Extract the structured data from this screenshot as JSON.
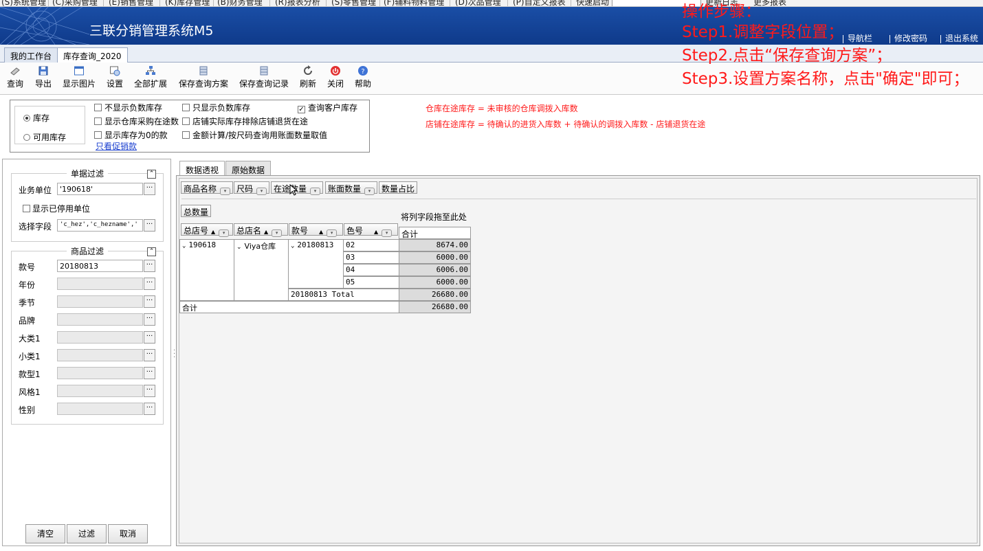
{
  "menu": {
    "items": [
      "(S)系统管理",
      "(C)采购管理",
      "(E)销售管理",
      "(K)库存管理",
      "(B)财务管理",
      "(R)报表分析",
      "(S)零售管理",
      "(F)辅料物料管理",
      "(D)次品管理",
      "(P)自定义报表"
    ],
    "quick_label": "快速启动",
    "changelog": "更新日志",
    "more_reports": "更多报表"
  },
  "banner": {
    "title": "三联分销管理系统M5",
    "links": [
      "导航栏",
      "修改密码",
      "退出系统"
    ]
  },
  "tabs": [
    "我的工作台",
    "库存查询_2020"
  ],
  "toolbar": {
    "buttons": [
      "查询",
      "导出",
      "显示图片",
      "设置",
      "全部扩展",
      "保存查询方案",
      "保存查询记录",
      "刷新",
      "关闭",
      "帮助"
    ]
  },
  "steps": {
    "title": "操作步骤：",
    "s1": "Step1.调整字段位置；",
    "s2": "Step2.点击“保存查询方案”；",
    "s3": "Step3.设置方案名称，点击\"确定\"即可；"
  },
  "options": {
    "radios": [
      {
        "label": "库存",
        "checked": true
      },
      {
        "label": "可用库存",
        "checked": false
      }
    ],
    "checks": [
      {
        "label": "不显示负数库存",
        "checked": false
      },
      {
        "label": "只显示负数库存",
        "checked": false
      },
      {
        "label": "查询客户库存",
        "checked": true
      },
      {
        "label": "显示仓库采购在途数",
        "checked": false
      },
      {
        "label": "店铺实际库存排除店铺退货在途",
        "checked": false
      },
      {
        "label": "显示库存为0的款",
        "checked": false
      },
      {
        "label": "金额计算/按尺码查询用账面数量取值",
        "checked": false
      }
    ],
    "promo_link": "只看促销款"
  },
  "notes": {
    "n1": "仓库在途库存 = 未审核的仓库调拨入库数",
    "n2": "店铺在途库存 = 待确认的进货入库数 + 待确认的调拨入库数 - 店铺退货在途"
  },
  "bill_filter": {
    "title": "单据过滤",
    "unit_label": "业务单位",
    "unit_value": "'190618'",
    "show_disabled": "显示已停用单位",
    "field_label": "选择字段",
    "field_value": "'c_hez','c_hezname','"
  },
  "goods_filter": {
    "title": "商品过滤",
    "rows": [
      {
        "label": "款号",
        "value": "20180813"
      },
      {
        "label": "年份",
        "value": ""
      },
      {
        "label": "季节",
        "value": ""
      },
      {
        "label": "品牌",
        "value": ""
      },
      {
        "label": "大类1",
        "value": ""
      },
      {
        "label": "小类1",
        "value": ""
      },
      {
        "label": "款型1",
        "value": ""
      },
      {
        "label": "风格1",
        "value": ""
      },
      {
        "label": "性别",
        "value": ""
      }
    ]
  },
  "bottom_buttons": [
    "清空",
    "过滤",
    "取消"
  ],
  "right_tabs": [
    "数据透视",
    "原始数据"
  ],
  "pivot": {
    "filter_fields": [
      "商品名称",
      "尺码",
      "在途数量",
      "账面数量",
      "数量占比"
    ],
    "data_field": "总数量",
    "drop_hint": "将列字段拖至此处",
    "row_fields": [
      "总店号",
      "总店名",
      "款号",
      "色号"
    ],
    "total_header": "合计",
    "shop_no": "190618",
    "shop_name": "Viya仓库",
    "style_no": "20180813",
    "colors": [
      "02",
      "03",
      "04",
      "05"
    ],
    "values": [
      "8674.00",
      "6000.00",
      "6006.00",
      "6000.00"
    ],
    "style_total_label": "20180813 Total",
    "style_total": "26680.00",
    "grand_label": "合计",
    "grand_total": "26680.00"
  }
}
